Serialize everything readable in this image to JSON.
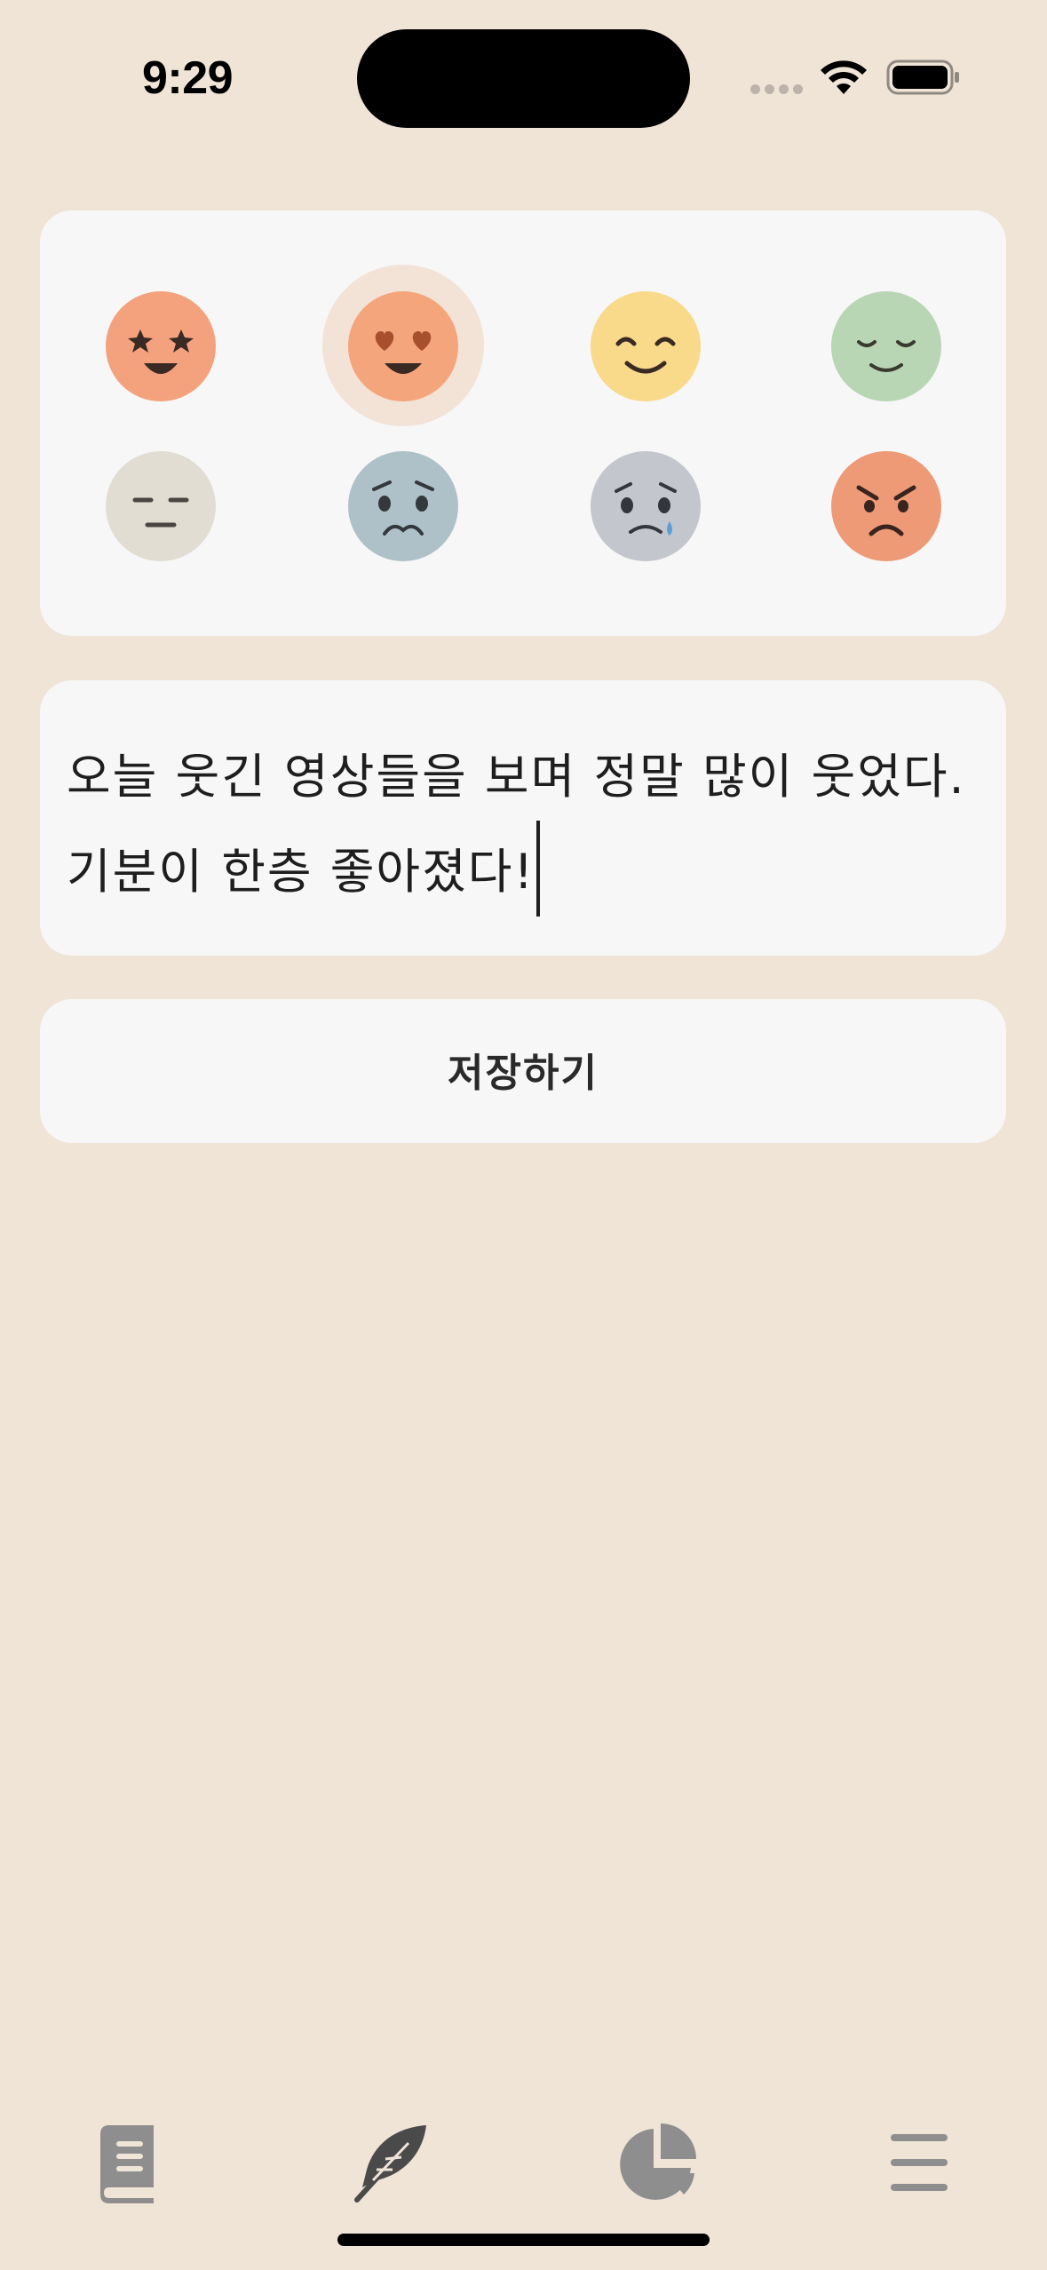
{
  "status_bar": {
    "time": "9:29"
  },
  "mood_picker": {
    "moods": [
      {
        "name": "star-struck",
        "color": "#F4A27E"
      },
      {
        "name": "heart-eyes",
        "color": "#F5A57C",
        "selected": true
      },
      {
        "name": "smiling",
        "color": "#F9D98A"
      },
      {
        "name": "relieved",
        "color": "#B9D6B4"
      },
      {
        "name": "neutral",
        "color": "#E2DDD2"
      },
      {
        "name": "worried",
        "color": "#AFC1C8"
      },
      {
        "name": "crying",
        "color": "#C3C6CC"
      },
      {
        "name": "angry",
        "color": "#EE9A77"
      }
    ]
  },
  "entry": {
    "text": "오늘 웃긴 영상들을 보며 정말 많이 웃었다. 기분이 한층 좋아졌다!"
  },
  "save_button": {
    "label": "저장하기"
  },
  "tab_bar": {
    "tabs": [
      {
        "icon": "book-icon",
        "active": false
      },
      {
        "icon": "feather-icon",
        "active": true
      },
      {
        "icon": "pie-chart-icon",
        "active": false
      },
      {
        "icon": "menu-icon",
        "active": false
      }
    ]
  },
  "colors": {
    "background": "#F0E4D7",
    "card": "#F7F7F7",
    "selection_ring": "#F2E3D6",
    "tab_inactive": "#8E8E8E",
    "tab_active": "#4A4A4A"
  }
}
